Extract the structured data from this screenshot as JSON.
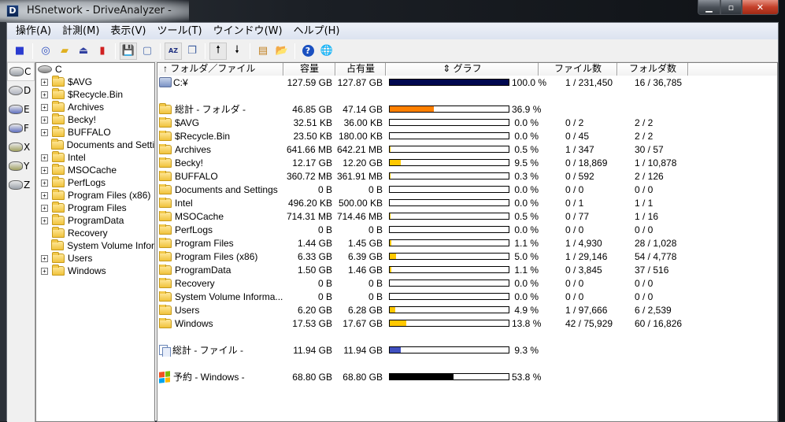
{
  "window": {
    "title": "HSnetwork - DriveAnalyzer -",
    "app_icon_letter": "D",
    "buttons": {
      "minimize": "▁",
      "maximize": "▫",
      "close": "✕"
    }
  },
  "menu": [
    {
      "label": "操作(A)"
    },
    {
      "label": "計測(M)"
    },
    {
      "label": "表示(V)"
    },
    {
      "label": "ツール(T)"
    },
    {
      "label": "ウインドウ(W)"
    },
    {
      "label": "ヘルプ(H)"
    }
  ],
  "toolbar": [
    {
      "name": "stop-icon",
      "glyph": "■",
      "color": "#2a3bd0"
    },
    {
      "name": "measure-drive-icon",
      "glyph": "◎",
      "color": "#3050c0"
    },
    {
      "name": "measure-folder-icon",
      "glyph": "▰",
      "color": "#e0b020"
    },
    {
      "name": "scan-icon",
      "glyph": "⏏",
      "color": "#3040a0"
    },
    {
      "name": "compare-icon",
      "glyph": "▮",
      "color": "#d02020"
    },
    {
      "name": "save-icon",
      "glyph": "💾",
      "color": "#3040a0",
      "pressed": true
    },
    {
      "name": "page-icon",
      "glyph": "▢",
      "color": "#5070b0"
    },
    {
      "name": "sort-az-icon",
      "glyph": "AZ",
      "color": "#203080",
      "pressed": true
    },
    {
      "name": "copy-icon",
      "glyph": "❐",
      "color": "#4060a0"
    },
    {
      "name": "sort-up-icon",
      "glyph": "🠕",
      "color": "#000",
      "pressed": true
    },
    {
      "name": "sort-down-icon",
      "glyph": "🠗",
      "color": "#000"
    },
    {
      "name": "tree-view-icon",
      "glyph": "▤",
      "color": "#c08020"
    },
    {
      "name": "open-folder-icon",
      "glyph": "📂",
      "color": "#c09020"
    },
    {
      "name": "help-icon",
      "glyph": "?",
      "color": "#1a50c0"
    },
    {
      "name": "network-icon",
      "glyph": "🌐",
      "color": "#2080c0"
    }
  ],
  "drives": [
    {
      "letter": "C",
      "type": "hdd",
      "selected": true
    },
    {
      "letter": "D",
      "type": "cdrom"
    },
    {
      "letter": "E",
      "type": "removable"
    },
    {
      "letter": "F",
      "type": "removable"
    },
    {
      "letter": "X",
      "type": "network"
    },
    {
      "letter": "Y",
      "type": "network"
    },
    {
      "letter": "Z",
      "type": "hdd"
    }
  ],
  "tree": {
    "root": "C",
    "items": [
      {
        "label": "$AVG",
        "expandable": true
      },
      {
        "label": "$Recycle.Bin",
        "expandable": true
      },
      {
        "label": "Archives",
        "expandable": true
      },
      {
        "label": "Becky!",
        "expandable": true
      },
      {
        "label": "BUFFALO",
        "expandable": true
      },
      {
        "label": "Documents and Setti",
        "expandable": false
      },
      {
        "label": "Intel",
        "expandable": true
      },
      {
        "label": "MSOCache",
        "expandable": true
      },
      {
        "label": "PerfLogs",
        "expandable": true
      },
      {
        "label": "Program Files (x86)",
        "expandable": true
      },
      {
        "label": "Program Files",
        "expandable": true
      },
      {
        "label": "ProgramData",
        "expandable": true
      },
      {
        "label": "Recovery",
        "expandable": false
      },
      {
        "label": "System Volume Infor",
        "expandable": false
      },
      {
        "label": "Users",
        "expandable": true
      },
      {
        "label": "Windows",
        "expandable": true
      }
    ]
  },
  "columns": {
    "name": "↑  フォルダ／ファイル",
    "size": "容量",
    "used": "占有量",
    "graph": "⇕    グラフ",
    "files": "ファイル数",
    "folders": "フォルダ数"
  },
  "colors": {
    "drive_bar": "#000850",
    "total_folder_bar": "#ff8000",
    "folder_bar": "#ffc800",
    "files_bar": "#4050c0",
    "windows_bar": "#000000"
  },
  "drive_row": {
    "name": "C:¥",
    "size": "127.59 GB",
    "used": "127.87 GB",
    "percent": 100.0,
    "percent_label": "100.0 %",
    "files": "1 / 231,450",
    "folders": "16 / 36,785"
  },
  "total_folders_row": {
    "name": "総計 - フォルダ -",
    "size": "46.85 GB",
    "used": "47.14 GB",
    "percent": 36.9,
    "percent_label": "36.9 %"
  },
  "rows": [
    {
      "name": "$AVG",
      "size": "32.51 KB",
      "used": "36.00 KB",
      "percent": 0.0,
      "percent_label": "0.0 %",
      "files": "0 / 2",
      "folders": "2 / 2"
    },
    {
      "name": "$Recycle.Bin",
      "size": "23.50 KB",
      "used": "180.00 KB",
      "percent": 0.0,
      "percent_label": "0.0 %",
      "files": "0 / 45",
      "folders": "2 / 2"
    },
    {
      "name": "Archives",
      "size": "641.66 MB",
      "used": "642.21 MB",
      "percent": 0.5,
      "percent_label": "0.5 %",
      "files": "1 / 347",
      "folders": "30 / 57"
    },
    {
      "name": "Becky!",
      "size": "12.17 GB",
      "used": "12.20 GB",
      "percent": 9.5,
      "percent_label": "9.5 %",
      "files": "0 / 18,869",
      "folders": "1 / 10,878"
    },
    {
      "name": "BUFFALO",
      "size": "360.72 MB",
      "used": "361.91 MB",
      "percent": 0.3,
      "percent_label": "0.3 %",
      "files": "0 / 592",
      "folders": "2 / 126"
    },
    {
      "name": "Documents and Settings",
      "size": "0 B",
      "used": "0 B",
      "percent": 0.0,
      "percent_label": "0.0 %",
      "files": "0 / 0",
      "folders": "0 / 0"
    },
    {
      "name": "Intel",
      "size": "496.20 KB",
      "used": "500.00 KB",
      "percent": 0.0,
      "percent_label": "0.0 %",
      "files": "0 / 1",
      "folders": "1 / 1"
    },
    {
      "name": "MSOCache",
      "size": "714.31 MB",
      "used": "714.46 MB",
      "percent": 0.5,
      "percent_label": "0.5 %",
      "files": "0 / 77",
      "folders": "1 / 16"
    },
    {
      "name": "PerfLogs",
      "size": "0 B",
      "used": "0 B",
      "percent": 0.0,
      "percent_label": "0.0 %",
      "files": "0 / 0",
      "folders": "0 / 0"
    },
    {
      "name": "Program Files",
      "size": "1.44 GB",
      "used": "1.45 GB",
      "percent": 1.1,
      "percent_label": "1.1 %",
      "files": "1 / 4,930",
      "folders": "28 / 1,028"
    },
    {
      "name": "Program Files (x86)",
      "size": "6.33 GB",
      "used": "6.39 GB",
      "percent": 5.0,
      "percent_label": "5.0 %",
      "files": "1 / 29,146",
      "folders": "54 / 4,778"
    },
    {
      "name": "ProgramData",
      "size": "1.50 GB",
      "used": "1.46 GB",
      "percent": 1.1,
      "percent_label": "1.1 %",
      "files": "0 / 3,845",
      "folders": "37 / 516"
    },
    {
      "name": "Recovery",
      "size": "0 B",
      "used": "0 B",
      "percent": 0.0,
      "percent_label": "0.0 %",
      "files": "0 / 0",
      "folders": "0 / 0"
    },
    {
      "name": "System Volume Informa...",
      "size": "0 B",
      "used": "0 B",
      "percent": 0.0,
      "percent_label": "0.0 %",
      "files": "0 / 0",
      "folders": "0 / 0"
    },
    {
      "name": "Users",
      "size": "6.20 GB",
      "used": "6.28 GB",
      "percent": 4.9,
      "percent_label": "4.9 %",
      "files": "1 / 97,666",
      "folders": "6 / 2,539"
    },
    {
      "name": "Windows",
      "size": "17.53 GB",
      "used": "17.67 GB",
      "percent": 13.8,
      "percent_label": "13.8 %",
      "files": "42 / 75,929",
      "folders": "60 / 16,826"
    }
  ],
  "total_files_row": {
    "name": "総計 - ファイル -",
    "size": "11.94 GB",
    "used": "11.94 GB",
    "percent": 9.3,
    "percent_label": "9.3 %"
  },
  "reserved_row": {
    "name": "予約 - Windows -",
    "size": "68.80 GB",
    "used": "68.80 GB",
    "percent": 53.8,
    "percent_label": "53.8 %"
  }
}
